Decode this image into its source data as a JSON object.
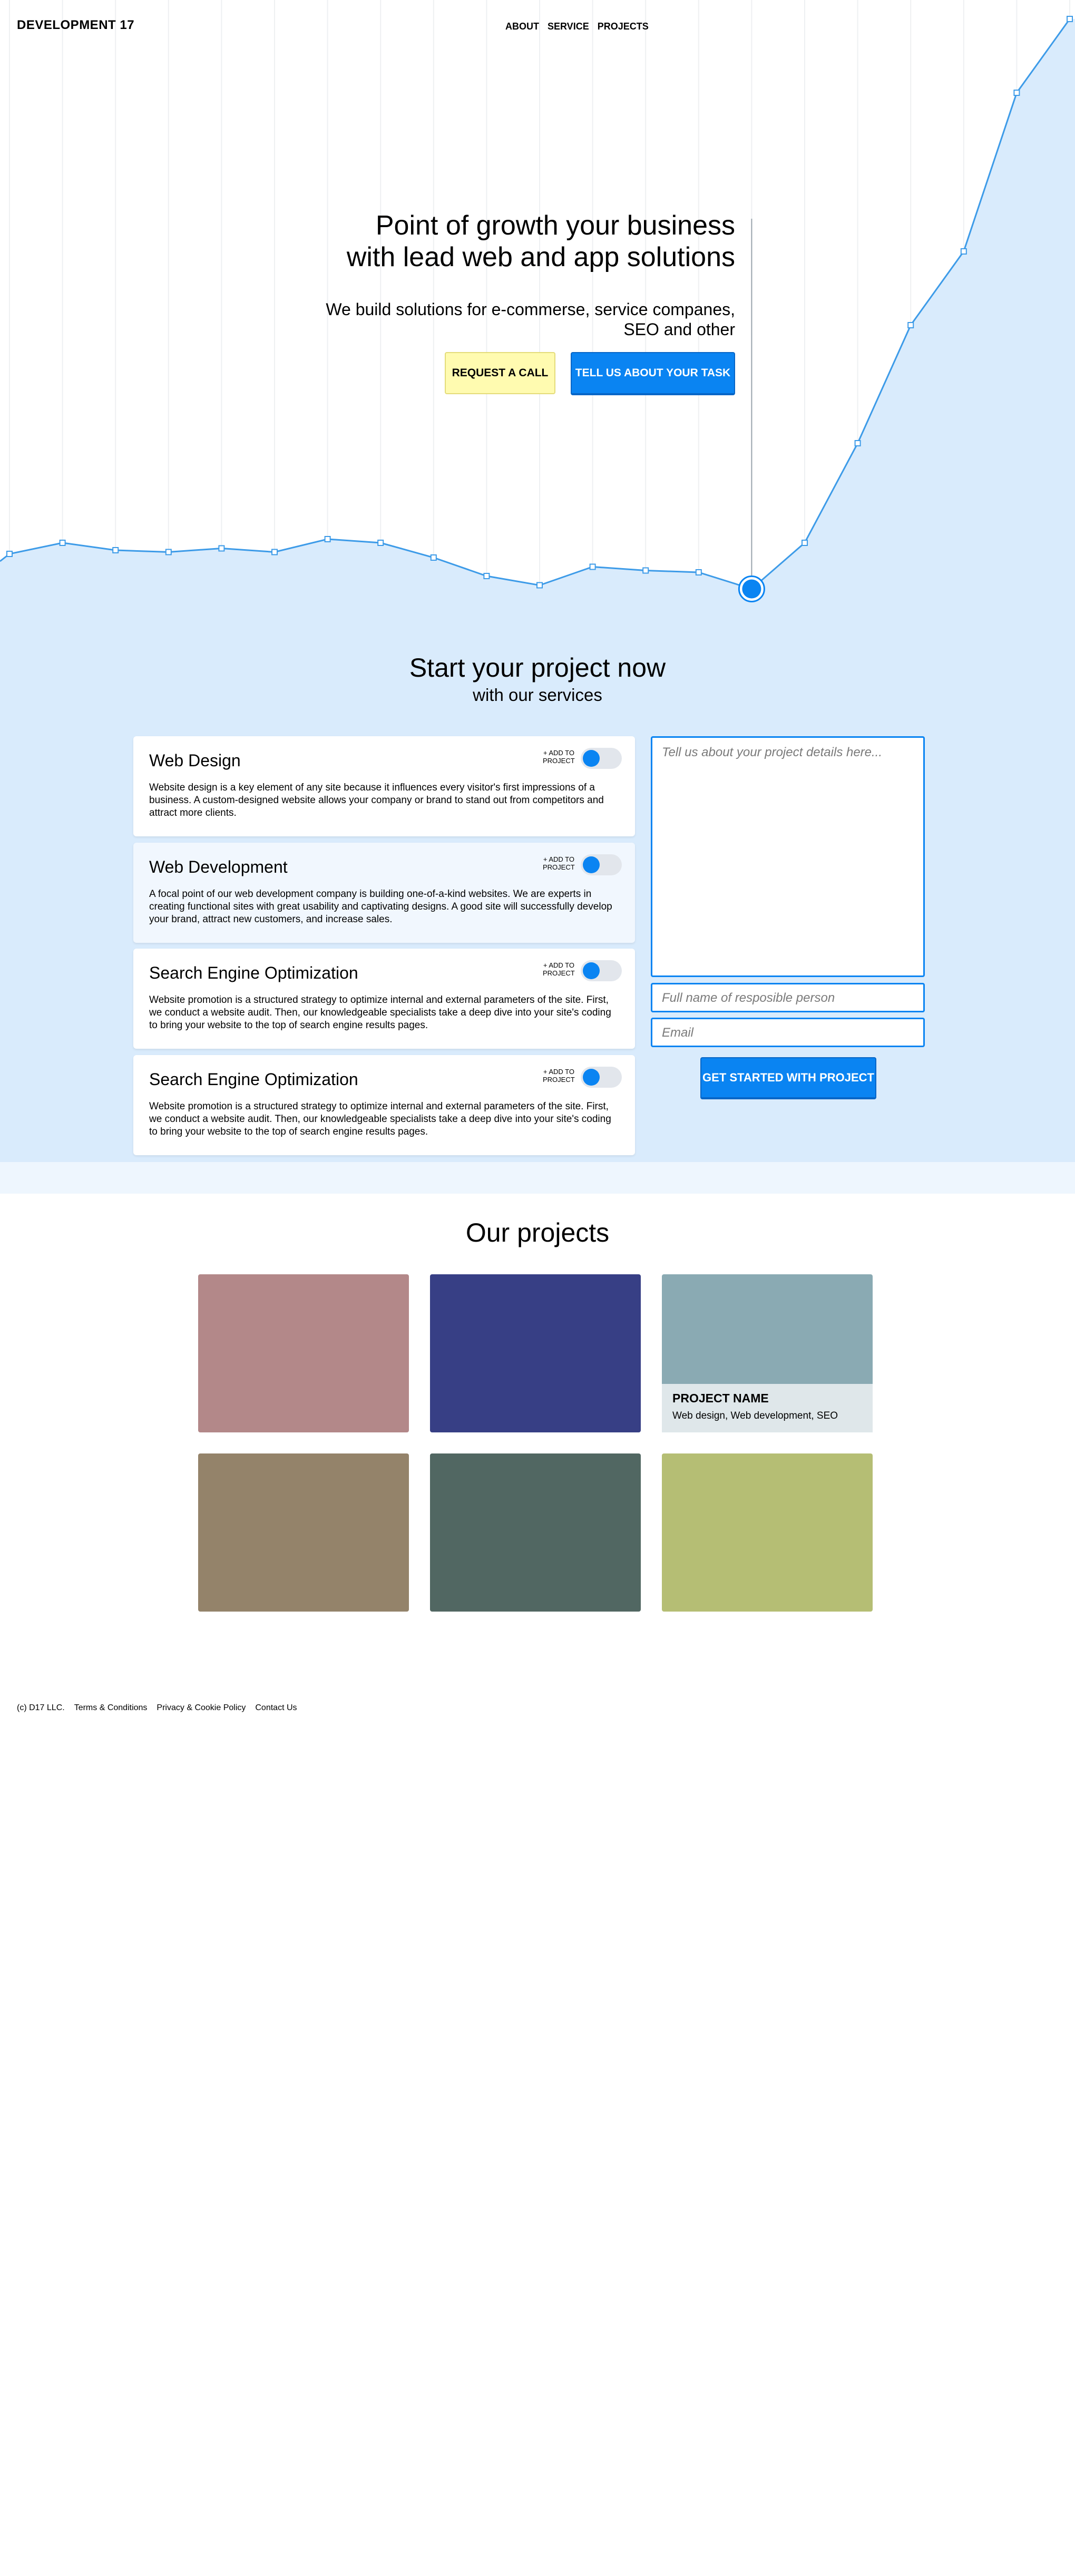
{
  "header": {
    "logo": "DEVELOPMENT 17",
    "nav": [
      "ABOUT",
      "SERVICE",
      "PROJECTS"
    ]
  },
  "hero": {
    "title_line1": "Point of growth your business",
    "title_line2": "with lead web and app solutions",
    "subtitle_line1": "We build solutions for e-commerse, service companes,",
    "subtitle_line2": "SEO and other",
    "request_call_label": "REQUEST A CALL",
    "tell_task_label": "TELL US ABOUT YOUR TASK"
  },
  "chart_data": {
    "type": "area",
    "x": [
      0,
      1,
      2,
      3,
      4,
      5,
      6,
      7,
      8,
      9,
      10,
      11,
      12,
      13,
      14,
      15,
      16,
      17,
      18,
      19,
      20
    ],
    "values": [
      0.12,
      0.15,
      0.13,
      0.125,
      0.135,
      0.125,
      0.16,
      0.15,
      0.11,
      0.06,
      0.035,
      0.085,
      0.075,
      0.07,
      0.025,
      0.15,
      0.42,
      0.74,
      0.94,
      1.37,
      1.57
    ],
    "highlight_index": 14,
    "grid": true,
    "colors": {
      "line": "#3d9be8",
      "fill": "#d9ebfc",
      "marker": "#0a84f2"
    }
  },
  "services": {
    "title": "Start your project now",
    "subtitle": "with our services",
    "add_label_1": "+ ADD TO",
    "add_label_2": "PROJECT",
    "items": [
      {
        "title": "Web Design",
        "description": "Website design is a key element of any site because it influences every visitor's first impressions of a business. A custom-designed website allows your company or brand to stand out from competitors and attract more clients."
      },
      {
        "title": "Web Development",
        "description": "A focal point of our web development company is building one-of-a-kind websites. We are experts in creating functional sites with great usability and captivating designs. A good site will successfully develop your brand, attract new customers, and increase sales."
      },
      {
        "title": "Search Engine Optimization",
        "description": "Website promotion is a structured strategy to optimize internal and  external parameters of the site. First, we conduct a website audit. Then, our knowledgeable specialists take a deep dive into your site's coding to bring your website to the top of search engine results pages."
      },
      {
        "title": "Search Engine Optimization",
        "description": "Website promotion is a structured strategy to optimize internal and  external parameters of the site. First, we conduct a website audit. Then, our knowledgeable specialists take a deep dive into your site's coding to bring your website to the top of search engine results pages."
      }
    ]
  },
  "form": {
    "details_placeholder": "Tell us about your project details here...",
    "name_placeholder": "Full name of resposible person",
    "email_placeholder": "Email",
    "submit_label": "GET STARTED WITH PROJECT"
  },
  "projects": {
    "title": "Our projects",
    "tile_colors": [
      "#b38889",
      "#373f85",
      "#8aaab3",
      "#94836a",
      "#516762",
      "#b5be74"
    ],
    "featured": {
      "name": "PROJECT NAME",
      "tags": "Web design, Web development, SEO"
    }
  },
  "footer": {
    "copyright": "(c) D17 LLC.",
    "links": [
      "Terms & Conditions",
      "Privacy & Cookie Policy",
      "Contact Us"
    ]
  }
}
